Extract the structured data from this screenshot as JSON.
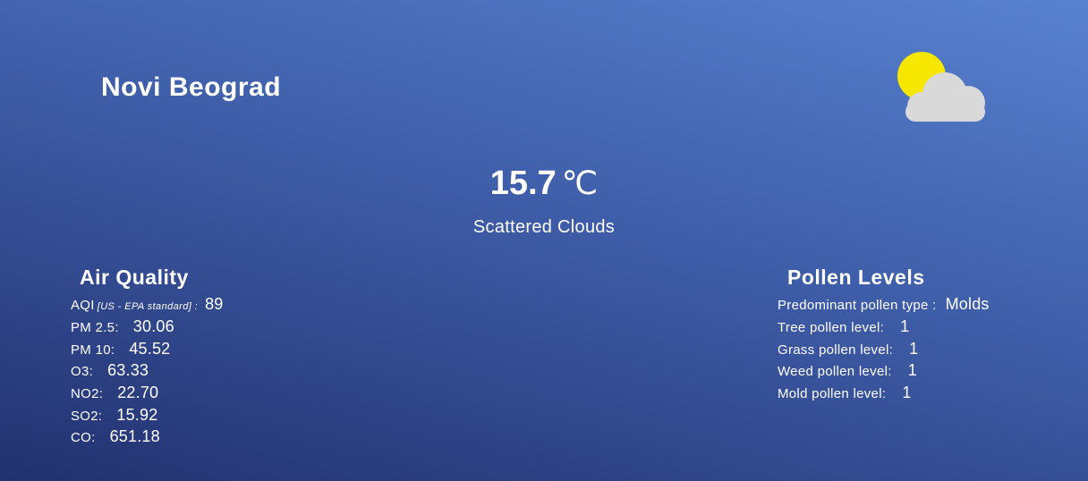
{
  "location": {
    "city": "Novi Beograd"
  },
  "current": {
    "temperature": "15.7",
    "unit": "℃",
    "description": "Scattered Clouds",
    "icon": "partly-cloudy-icon"
  },
  "air_quality": {
    "title": "Air Quality",
    "aqi": {
      "label": "AQI",
      "standard": "[US - EPA standard] :",
      "value": "89"
    },
    "pm25": {
      "label": "PM 2.5:",
      "value": "30.06"
    },
    "pm10": {
      "label": "PM 10:",
      "value": "45.52"
    },
    "o3": {
      "label": "O3:",
      "value": "63.33"
    },
    "no2": {
      "label": "NO2:",
      "value": "22.70"
    },
    "so2": {
      "label": "SO2:",
      "value": "15.92"
    },
    "co": {
      "label": "CO:",
      "value": "651.18"
    }
  },
  "pollen": {
    "title": "Pollen Levels",
    "predominant": {
      "label": "Predominant pollen type :",
      "value": "Molds"
    },
    "tree": {
      "label": "Tree pollen level:",
      "value": "1"
    },
    "grass": {
      "label": "Grass pollen level:",
      "value": "1"
    },
    "weed": {
      "label": "Weed pollen level:",
      "value": "1"
    },
    "mold": {
      "label": "Mold pollen level:",
      "value": "1"
    }
  },
  "colors": {
    "sun": "#f7e600",
    "cloud": "#d9d9d9",
    "text": "#ffffff"
  }
}
